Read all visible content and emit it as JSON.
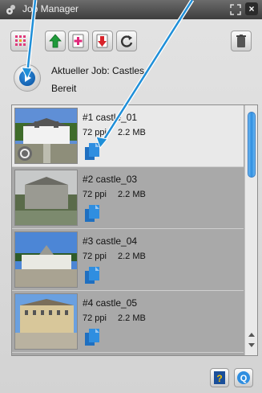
{
  "window": {
    "title": "Job Manager",
    "close_label": "×"
  },
  "toolbar": {
    "buttons": [
      {
        "icon": "grid-icon",
        "name": "grid-view-button"
      },
      {
        "icon": "move-up-icon",
        "name": "move-up-button"
      },
      {
        "icon": "add-job-icon",
        "name": "add-job-button"
      },
      {
        "icon": "remove-job-icon",
        "name": "remove-job-button"
      },
      {
        "icon": "refresh-icon",
        "name": "refresh-button"
      },
      {
        "icon": "trash-icon",
        "name": "trash-button"
      }
    ]
  },
  "job": {
    "current_label": "Aktueller Job: Castles",
    "status": "Bereit"
  },
  "list": {
    "items": [
      {
        "title": "#1 castle_01",
        "ppi": "72 ppi",
        "size": "2.2 MB",
        "selected": true
      },
      {
        "title": "#2 castle_03",
        "ppi": "72 ppi",
        "size": "2.2 MB",
        "selected": false
      },
      {
        "title": "#3 castle_04",
        "ppi": "72 ppi",
        "size": "2.2 MB",
        "selected": false
      },
      {
        "title": "#4 castle_05",
        "ppi": "72 ppi",
        "size": "2.2 MB",
        "selected": false
      }
    ],
    "scroll_position": 0.0
  },
  "footer": {
    "help_label": "?",
    "search_label": "Q"
  },
  "colors": {
    "accent": "#2f8ee0",
    "doc_icon": "#2a7fd1",
    "selected_row": "#e9e9e9",
    "row": "#a9a9a9"
  }
}
